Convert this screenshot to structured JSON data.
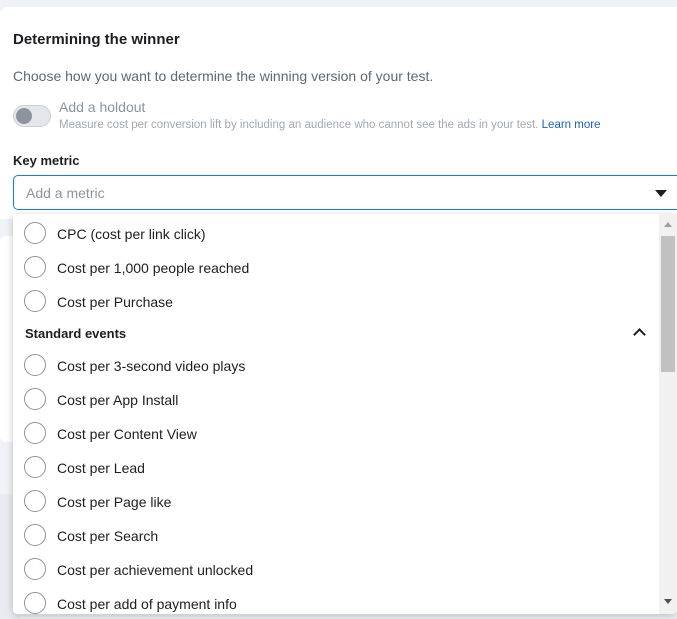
{
  "card": {
    "title": "Determining the winner",
    "subtitle": "Choose how you want to determine the winning version of your test.",
    "holdout": {
      "label": "Add a holdout",
      "description": "Measure cost per conversion lift by including an audience who cannot see the ads in your test.",
      "learn_more": "Learn more",
      "enabled": false
    },
    "key_metric": {
      "label": "Key metric",
      "placeholder": "Add a metric"
    }
  },
  "dropdown": {
    "top_options": [
      {
        "label": "CPC (cost per link click)"
      },
      {
        "label": "Cost per 1,000 people reached"
      },
      {
        "label": "Cost per Purchase"
      }
    ],
    "section": {
      "label": "Standard events",
      "expanded": true
    },
    "section_options": [
      {
        "label": "Cost per 3-second video plays"
      },
      {
        "label": "Cost per App Install"
      },
      {
        "label": "Cost per Content View"
      },
      {
        "label": "Cost per Lead"
      },
      {
        "label": "Cost per Page like"
      },
      {
        "label": "Cost per Search"
      },
      {
        "label": "Cost per achievement unlocked"
      },
      {
        "label": "Cost per add of payment info"
      }
    ]
  },
  "icons": {
    "caret": "caret-down-icon",
    "section_toggle": "chevron-up-icon",
    "scroll_up": "scroll-up-arrow",
    "scroll_down": "scroll-down-arrow"
  },
  "colors": {
    "accent": "#1877f2",
    "link": "#1d5fc7",
    "muted_text": "#606770"
  }
}
